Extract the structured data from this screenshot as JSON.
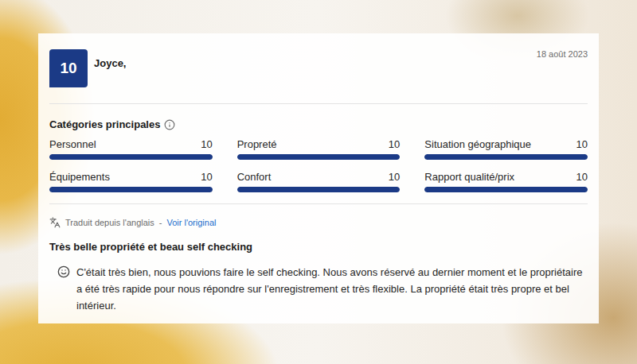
{
  "review": {
    "score": "10",
    "author": "Joyce,",
    "date": "18 août 2023"
  },
  "categories": {
    "title": "Catégories principales",
    "items": [
      {
        "label": "Personnel",
        "score": "10",
        "level": 1
      },
      {
        "label": "Propreté",
        "score": "10",
        "level": 1
      },
      {
        "label": "Situation géographique",
        "score": "10",
        "level": 1
      },
      {
        "label": "Équipements",
        "score": "10",
        "level": 1
      },
      {
        "label": "Confort",
        "score": "10",
        "level": 1
      },
      {
        "label": "Rapport qualité/prix",
        "score": "10",
        "level": 1
      }
    ]
  },
  "translation": {
    "note": "Traduit depuis l'anglais",
    "separator": "-",
    "link": "Voir l'original"
  },
  "title": "Très belle propriété et beau self checking",
  "body": "C'était très bien, nous pouvions faire le self checking. Nous avons réservé au dernier moment et le propriétaire a été très rapide pour nous répondre sur l'enregistrement et très flexible. La propriété était très propre et bel intérieur."
}
